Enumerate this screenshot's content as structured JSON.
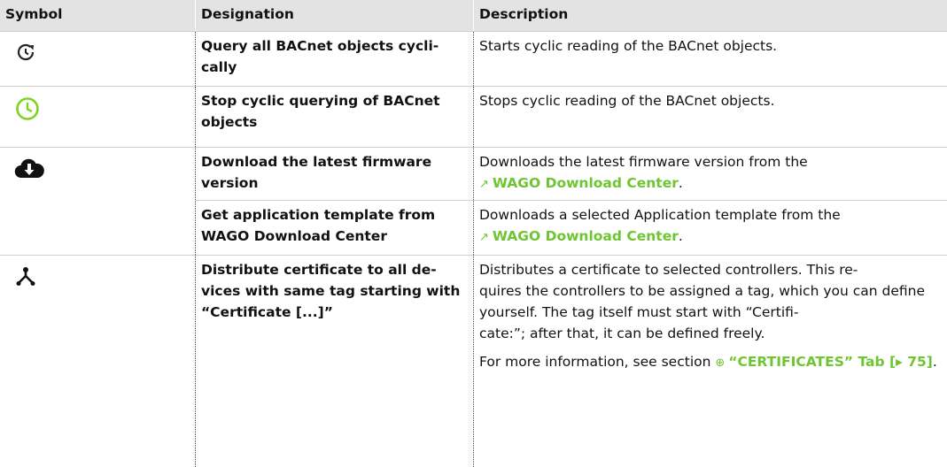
{
  "header": {
    "symbol": "Symbol",
    "designation": "Designation",
    "description": "Description"
  },
  "rows": [
    {
      "icon": "refresh-clock-icon",
      "designation": "Query all BACnet objects cycli-\ncally",
      "description": "Starts cyclic reading of the BACnet objects."
    },
    {
      "icon": "green-clock-icon",
      "designation": "Stop cyclic querying of BACnet objects",
      "description": "Stops cyclic reading of the BACnet objects."
    },
    {
      "icon": "cloud-download-icon",
      "designation": "Download the latest firmware version",
      "description": "Downloads the latest firmware version from the",
      "link": "WAGO Download Center",
      "suffix": "."
    },
    {
      "designation": "Get application template from WAGO Download Center",
      "description": "Downloads a selected Application template from the",
      "link": "WAGO Download Center",
      "suffix": "."
    },
    {
      "icon": "distribute-network-icon",
      "designation": "Distribute certificate to all de-\nvices with same tag starting with “Certificate [...]”",
      "description": "Distributes a certificate to selected controllers. This re-\nquires the controllers to be assigned a tag, which you can define yourself. The tag itself must start with “Certifi-\ncate:”; after that, it can be defined freely.",
      "more_prefix": "For more information, see section",
      "more_link": "“CERTIFICATES” Tab [▸ 75]",
      "more_suffix": "."
    }
  ],
  "colors": {
    "link": "#6ec531",
    "header_bg": "#e3e3e3",
    "clock_green": "#7ed321"
  }
}
